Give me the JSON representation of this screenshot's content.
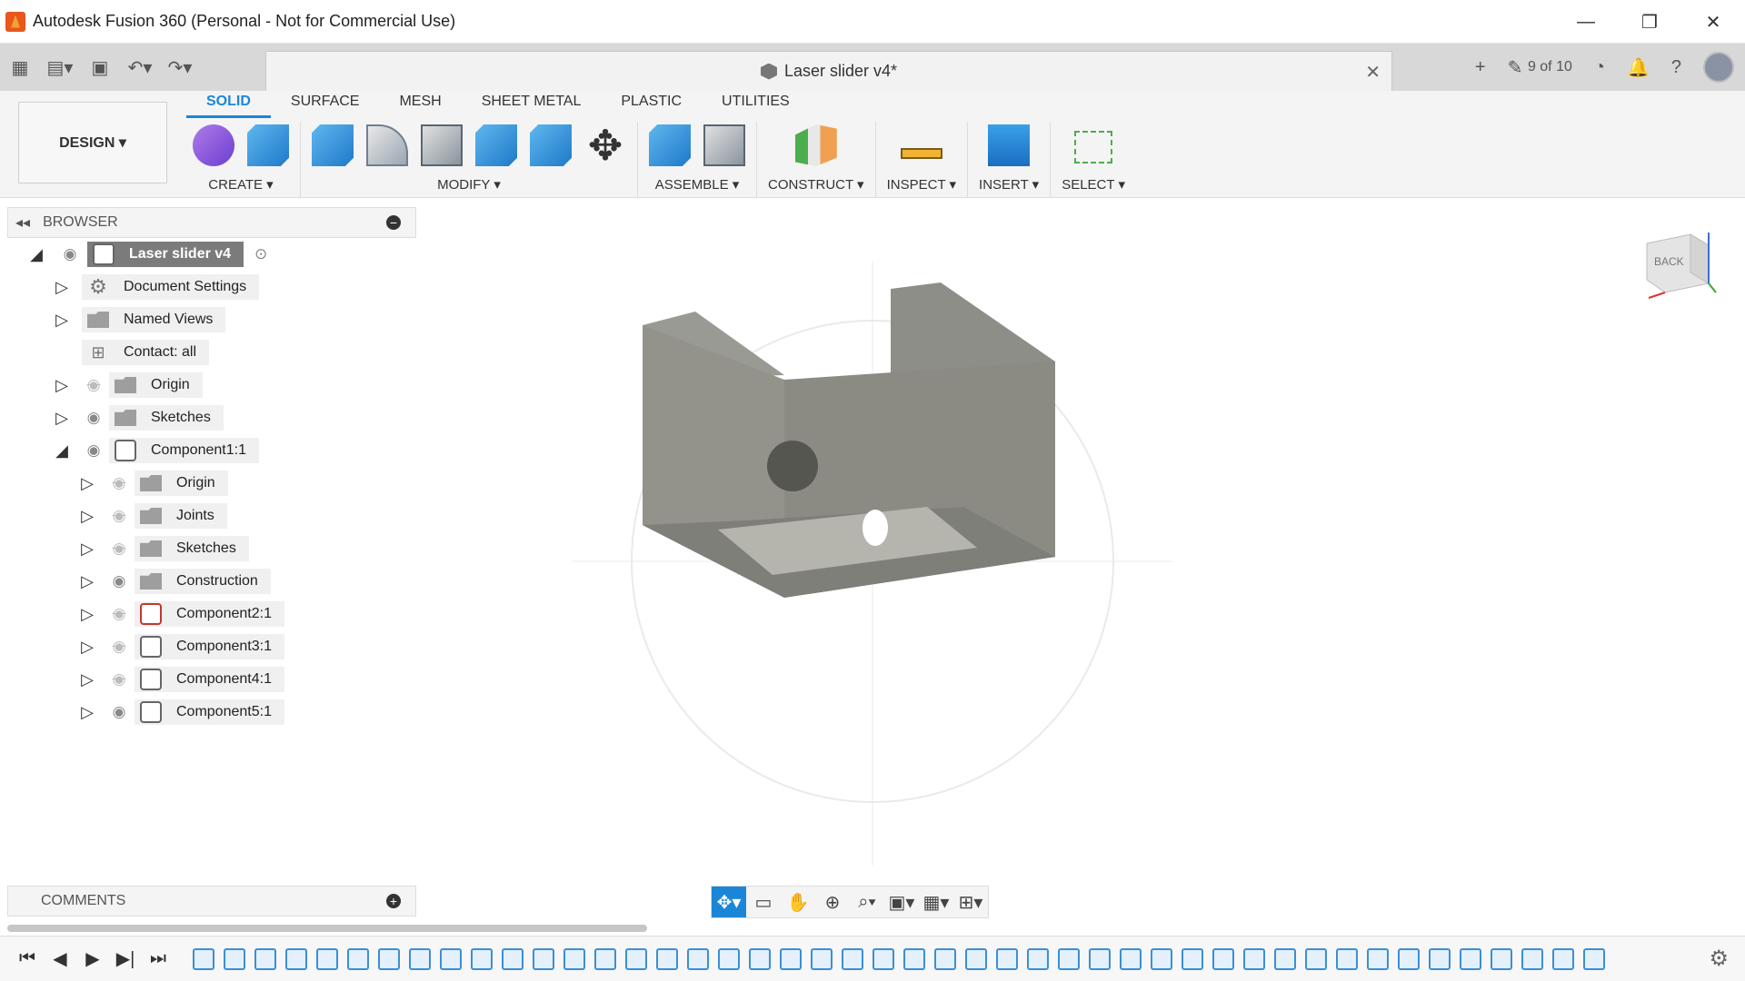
{
  "window": {
    "title": "Autodesk Fusion 360 (Personal - Not for Commercial Use)",
    "minimize": "—",
    "restore": "❐",
    "close": "✕"
  },
  "doc_tab": {
    "name": "Laser slider v4*",
    "close": "✕"
  },
  "qat_right": {
    "add": "+",
    "version": "9 of 10"
  },
  "ribbon": {
    "workspace": "DESIGN ▾",
    "tabs": [
      "SOLID",
      "SURFACE",
      "MESH",
      "SHEET METAL",
      "PLASTIC",
      "UTILITIES"
    ],
    "groups": {
      "create": "CREATE ▾",
      "modify": "MODIFY ▾",
      "assemble": "ASSEMBLE ▾",
      "construct": "CONSTRUCT ▾",
      "inspect": "INSPECT ▾",
      "insert": "INSERT ▾",
      "select": "SELECT ▾"
    }
  },
  "browser": {
    "title": "BROWSER",
    "items": [
      {
        "label": "Laser slider v4"
      },
      {
        "label": "Document Settings"
      },
      {
        "label": "Named Views"
      },
      {
        "label": "Contact: all"
      },
      {
        "label": "Origin"
      },
      {
        "label": "Sketches"
      },
      {
        "label": "Component1:1"
      },
      {
        "label": "Origin"
      },
      {
        "label": "Joints"
      },
      {
        "label": "Sketches"
      },
      {
        "label": "Construction"
      },
      {
        "label": "Component2:1"
      },
      {
        "label": "Component3:1"
      },
      {
        "label": "Component4:1"
      },
      {
        "label": "Component5:1"
      }
    ]
  },
  "comments": {
    "title": "COMMENTS"
  },
  "viewcube": {
    "face_label": "BACK"
  },
  "colors": {
    "accent": "#1b86d8",
    "model": "#8b8b84"
  }
}
